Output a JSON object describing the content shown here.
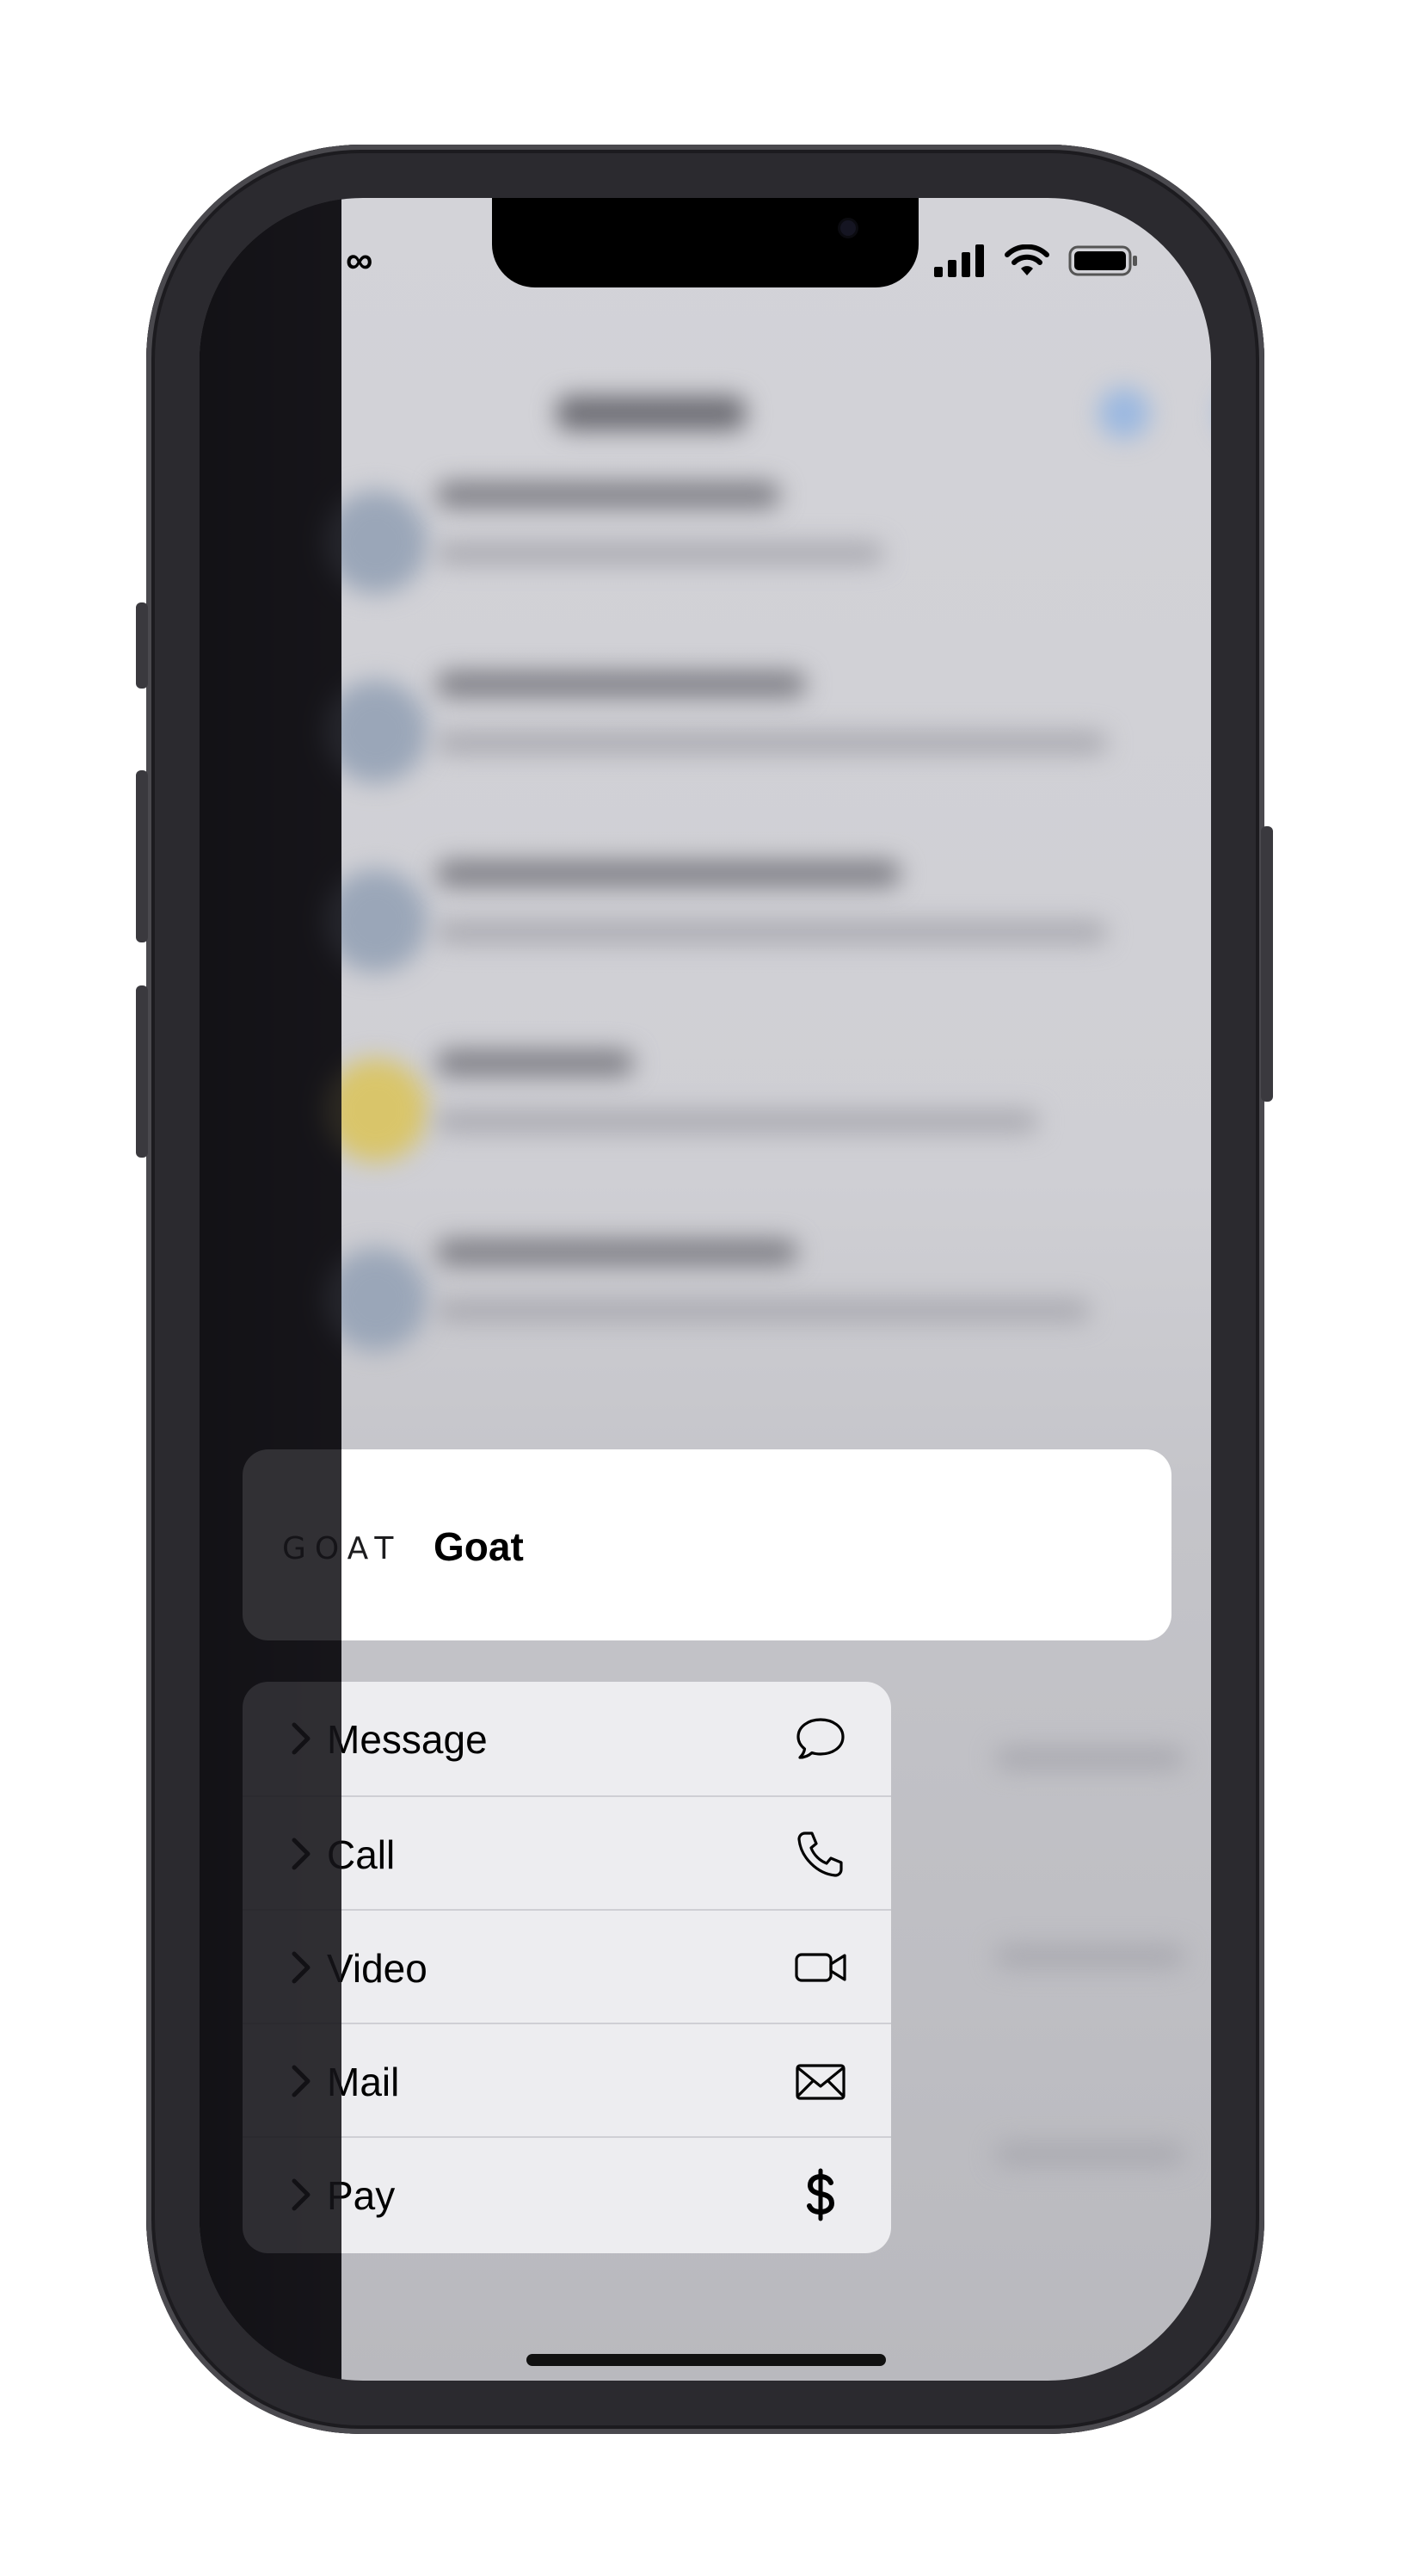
{
  "status_bar": {
    "left_glyph": "∞"
  },
  "contact_card": {
    "logo_text": "GOAT",
    "name": "Goat"
  },
  "menu": {
    "items": [
      {
        "label": "Message",
        "icon": "message-bubble-icon"
      },
      {
        "label": "Call",
        "icon": "phone-icon"
      },
      {
        "label": "Video",
        "icon": "video-camera-icon"
      },
      {
        "label": "Mail",
        "icon": "envelope-icon"
      },
      {
        "label": "Pay",
        "icon": "dollar-icon"
      }
    ]
  },
  "colors": {
    "card_bg": "#ffffff",
    "menu_bg": "#eeeef2",
    "frame": "#2b2a2f"
  }
}
